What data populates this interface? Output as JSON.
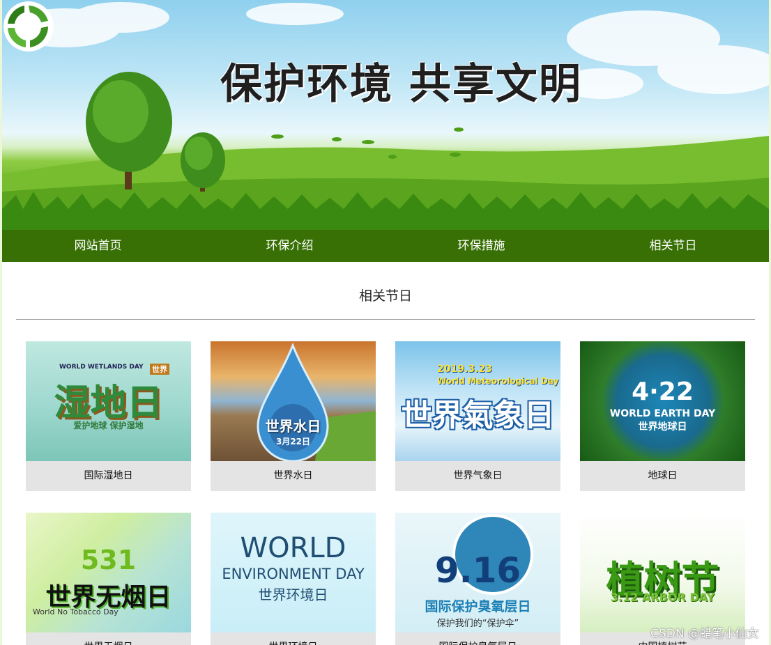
{
  "banner": {
    "title": "保护环境 共享文明"
  },
  "nav": {
    "items": [
      "网站首页",
      "环保介绍",
      "环保措施",
      "相关节日"
    ]
  },
  "section": {
    "title": "相关节日"
  },
  "cards": [
    {
      "caption": "国际湿地日",
      "art": "湿地日",
      "tag": "世界",
      "sub": "爱护地球 保护湿地",
      "en": "WORLD WETLANDS DAY"
    },
    {
      "caption": "世界水日",
      "art": "世界水日",
      "sub": "3月22日"
    },
    {
      "caption": "世界气象日",
      "art": "世界氣象日",
      "date": "2019.3.23",
      "en": "World Meteorological Day"
    },
    {
      "caption": "地球日",
      "num": "4·22",
      "en": "WORLD EARTH DAY",
      "art": "世界地球日"
    },
    {
      "caption": "世界无烟日",
      "num": "531",
      "art": "世界无烟日",
      "en": "World No Tobacco Day"
    },
    {
      "caption": "世界环境日",
      "en": "WORLD",
      "en2": "ENVIRONMENT DAY",
      "art": "世界环境日"
    },
    {
      "caption": "国际保护臭氧层日",
      "num": "9.16",
      "art": "国际保护臭氧层日",
      "sub": "保护我们的“保护伞”"
    },
    {
      "caption": "中国植树节",
      "art": "植树节",
      "en": "3.12 ARBOR DAY"
    }
  ],
  "watermark": "CSDN @蜡笔小仙女",
  "colors": {
    "nav": "#387005",
    "page_bg": "#eaf7d9"
  }
}
